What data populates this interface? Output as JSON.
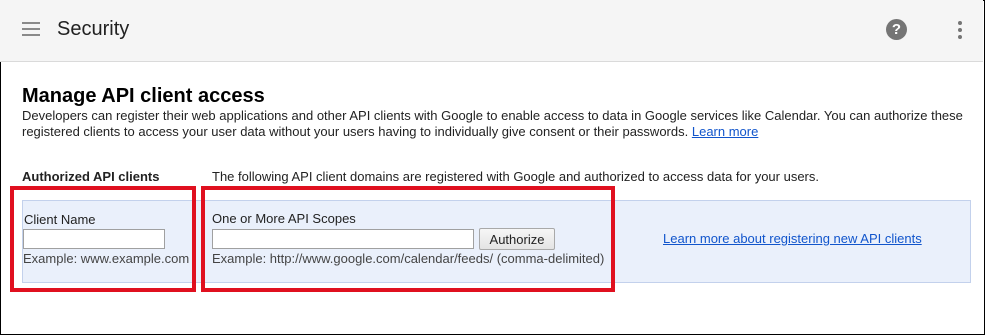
{
  "header": {
    "title": "Security",
    "menu_icon": "hamburger-menu-icon",
    "help_icon": "help-icon",
    "help_glyph": "?",
    "more_icon": "more-vert-icon"
  },
  "section": {
    "title": "Manage API client access",
    "description": "Developers can register their web applications and other API clients with Google to enable access to data in Google services like Calendar. You can authorize these registered clients to access your user data without your users having to individually give consent or their passwords.",
    "learn_more_label": "Learn more"
  },
  "authorized": {
    "label": "Authorized API clients",
    "description": "The following API client domains are registered with Google and authorized to access data for your users."
  },
  "form": {
    "client_name_label": "Client Name",
    "client_name_value": "",
    "client_name_example": "Example: www.example.com",
    "scopes_label": "One or More API Scopes",
    "scopes_value": "",
    "scopes_example": "Example: http://www.google.com/calendar/feeds/ (comma-delimited)",
    "authorize_label": "Authorize",
    "learn_more_api_label": "Learn more about registering new API clients"
  },
  "colors": {
    "accent_link": "#1155cc",
    "highlight": "#e0101f",
    "panel_bg": "#eaf0fb"
  }
}
